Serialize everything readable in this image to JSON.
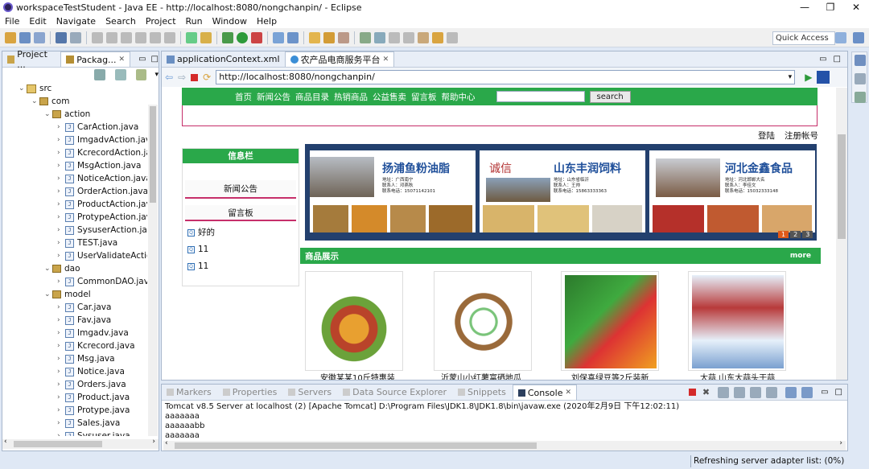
{
  "window": {
    "title": "workspaceTestStudent - Java EE - http://localhost:8080/nongchanpin/ - Eclipse"
  },
  "menu": [
    "File",
    "Edit",
    "Navigate",
    "Search",
    "Project",
    "Run",
    "Window",
    "Help"
  ],
  "quick_access": "Quick Access",
  "left_tabs": {
    "project": "Project ...",
    "package": "Packag..."
  },
  "tree": [
    {
      "label": "src",
      "level": 1,
      "kind": "src"
    },
    {
      "label": "com",
      "level": 2,
      "kind": "pkg"
    },
    {
      "label": "action",
      "level": 3,
      "kind": "pkg"
    },
    {
      "label": "CarAction.java",
      "level": 4,
      "kind": "java"
    },
    {
      "label": "ImgadvAction.java",
      "level": 4,
      "kind": "java"
    },
    {
      "label": "KcrecordAction.jav",
      "level": 4,
      "kind": "java"
    },
    {
      "label": "MsgAction.java",
      "level": 4,
      "kind": "java"
    },
    {
      "label": "NoticeAction.java",
      "level": 4,
      "kind": "java"
    },
    {
      "label": "OrderAction.java",
      "level": 4,
      "kind": "java"
    },
    {
      "label": "ProductAction.java",
      "level": 4,
      "kind": "java"
    },
    {
      "label": "ProtypeAction.java",
      "level": 4,
      "kind": "java"
    },
    {
      "label": "SysuserAction.java",
      "level": 4,
      "kind": "java"
    },
    {
      "label": "TEST.java",
      "level": 4,
      "kind": "java"
    },
    {
      "label": "UserValidateActio",
      "level": 4,
      "kind": "java"
    },
    {
      "label": "dao",
      "level": 3,
      "kind": "pkg"
    },
    {
      "label": "CommonDAO.java",
      "level": 4,
      "kind": "java"
    },
    {
      "label": "model",
      "level": 3,
      "kind": "pkg"
    },
    {
      "label": "Car.java",
      "level": 4,
      "kind": "java"
    },
    {
      "label": "Fav.java",
      "level": 4,
      "kind": "java"
    },
    {
      "label": "Imgadv.java",
      "level": 4,
      "kind": "java"
    },
    {
      "label": "Kcrecord.java",
      "level": 4,
      "kind": "java"
    },
    {
      "label": "Msg.java",
      "level": 4,
      "kind": "java"
    },
    {
      "label": "Notice.java",
      "level": 4,
      "kind": "java"
    },
    {
      "label": "Orders.java",
      "level": 4,
      "kind": "java"
    },
    {
      "label": "Product.java",
      "level": 4,
      "kind": "java"
    },
    {
      "label": "Protype.java",
      "level": 4,
      "kind": "java"
    },
    {
      "label": "Sales.java",
      "level": 4,
      "kind": "java"
    },
    {
      "label": "Sysuser.java",
      "level": 4,
      "kind": "java"
    }
  ],
  "editor_tabs": [
    {
      "label": "applicationContext.xml",
      "active": false
    },
    {
      "label": "农产品电商服务平台",
      "active": true
    }
  ],
  "browser": {
    "url": "http://localhost:8080/nongchanpin/"
  },
  "site": {
    "nav": [
      "首页",
      "新闻公告",
      "商品目录",
      "热销商品",
      "公益售卖",
      "留言板",
      "帮助中心"
    ],
    "search_value": "",
    "search_button": "search",
    "login": "登陆",
    "register": "注册帐号",
    "info_header": "信息栏",
    "info_news": "新闻公告",
    "info_board": "留言板",
    "messages": [
      "好的",
      "11",
      "11"
    ],
    "banners": [
      {
        "title": "扬浦鱼粉油脂",
        "line1": "地址：广西南宁",
        "line2": "联系人：邓燕秋",
        "line3": "联系电话：15071142101"
      },
      {
        "brand": "诚信",
        "title": "山东丰润饲料",
        "line1": "地址：山东省临沂",
        "line2": "联系人：王帅",
        "line3": "联系电话：15863333363"
      },
      {
        "title": "河北金鑫食品",
        "line1": "地址：河北邯郸大名",
        "line2": "联系人：李佳文",
        "line3": "联系电话：15032333148"
      }
    ],
    "pager": [
      "1",
      "2",
      "3"
    ],
    "products_header": "商品展示",
    "more": "more",
    "products": [
      "安徽某某10斤特惠装",
      "沂蒙山小红薯富硒地瓜",
      "刘保喜绿豆等2斤装新",
      "大蒜 山东大蒜头干蒜"
    ]
  },
  "bottom_tabs": [
    "Markers",
    "Properties",
    "Servers",
    "Data Source Explorer",
    "Snippets",
    "Console"
  ],
  "console": {
    "header": "Tomcat v8.5 Server at localhost (2) [Apache Tomcat] D:\\Program Files\\JDK1.8\\JDK1.8\\bin\\javaw.exe (2020年2月9日 下午12:02:11)",
    "lines": [
      "aaaaaaa",
      "aaaaaabb",
      "aaaaaaa"
    ]
  },
  "status": "Refreshing server adapter list: (0%)",
  "colors": {
    "green": "#2aa84a",
    "navy": "#23406e",
    "accent": "#2f6fb5"
  }
}
